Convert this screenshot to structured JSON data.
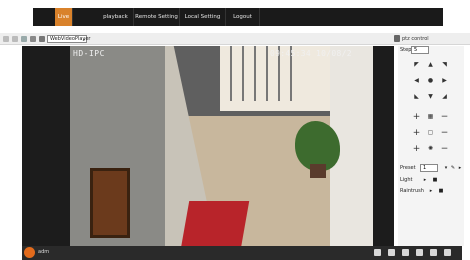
{
  "nav": {
    "tabs": [
      {
        "label": "Live"
      },
      {
        "label": "playback"
      },
      {
        "label": "Remote Setting"
      },
      {
        "label": "Local Setting"
      },
      {
        "label": "Logout"
      }
    ]
  },
  "toolbar": {
    "player_select": "WebVideoPlayer",
    "ptz_label": "ptz control"
  },
  "video": {
    "osd_name": "HD-IPC",
    "osd_time": "09:45:34 10/08/2"
  },
  "ptz": {
    "step_label": "Step",
    "step_value": "5",
    "preset_label": "Preset",
    "preset_value": "1",
    "light_label": "Light",
    "raintrush_label": "Raintrush"
  },
  "bottom": {
    "user": "adm"
  },
  "colors": {
    "active_tab": "#d9822b",
    "nav_bg": "#1a1a1a"
  }
}
